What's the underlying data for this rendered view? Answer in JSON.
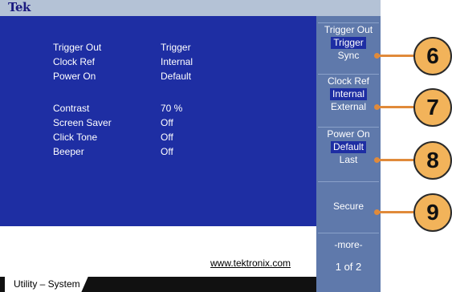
{
  "logo": "Tek",
  "settings": [
    {
      "label": "Trigger Out",
      "value": "Trigger"
    },
    {
      "label": "Clock Ref",
      "value": "Internal"
    },
    {
      "label": "Power On",
      "value": "Default"
    },
    {
      "label": "Contrast",
      "value": "70 %"
    },
    {
      "label": "Screen Saver",
      "value": "Off"
    },
    {
      "label": "Click Tone",
      "value": "Off"
    },
    {
      "label": "Beeper",
      "value": "Off"
    }
  ],
  "url": "www.tektronix.com",
  "tab": "Utility – System",
  "side_buttons": {
    "trigger_out": {
      "title": "Trigger Out",
      "selected": "Trigger",
      "other": "Sync"
    },
    "clock_ref": {
      "title": "Clock Ref",
      "selected": "Internal",
      "other": "External"
    },
    "power_on": {
      "title": "Power On",
      "selected": "Default",
      "other": "Last"
    },
    "secure": {
      "title": "Secure"
    },
    "more": {
      "title": "-more-",
      "page": "1 of 2"
    }
  },
  "callouts": [
    "6",
    "7",
    "8",
    "9"
  ],
  "colors": {
    "panel_blue": "#1e2ea3",
    "sidebar_blue": "#5f79ab",
    "callout_fill": "#f2b35a",
    "callout_line": "#e08a3a"
  }
}
